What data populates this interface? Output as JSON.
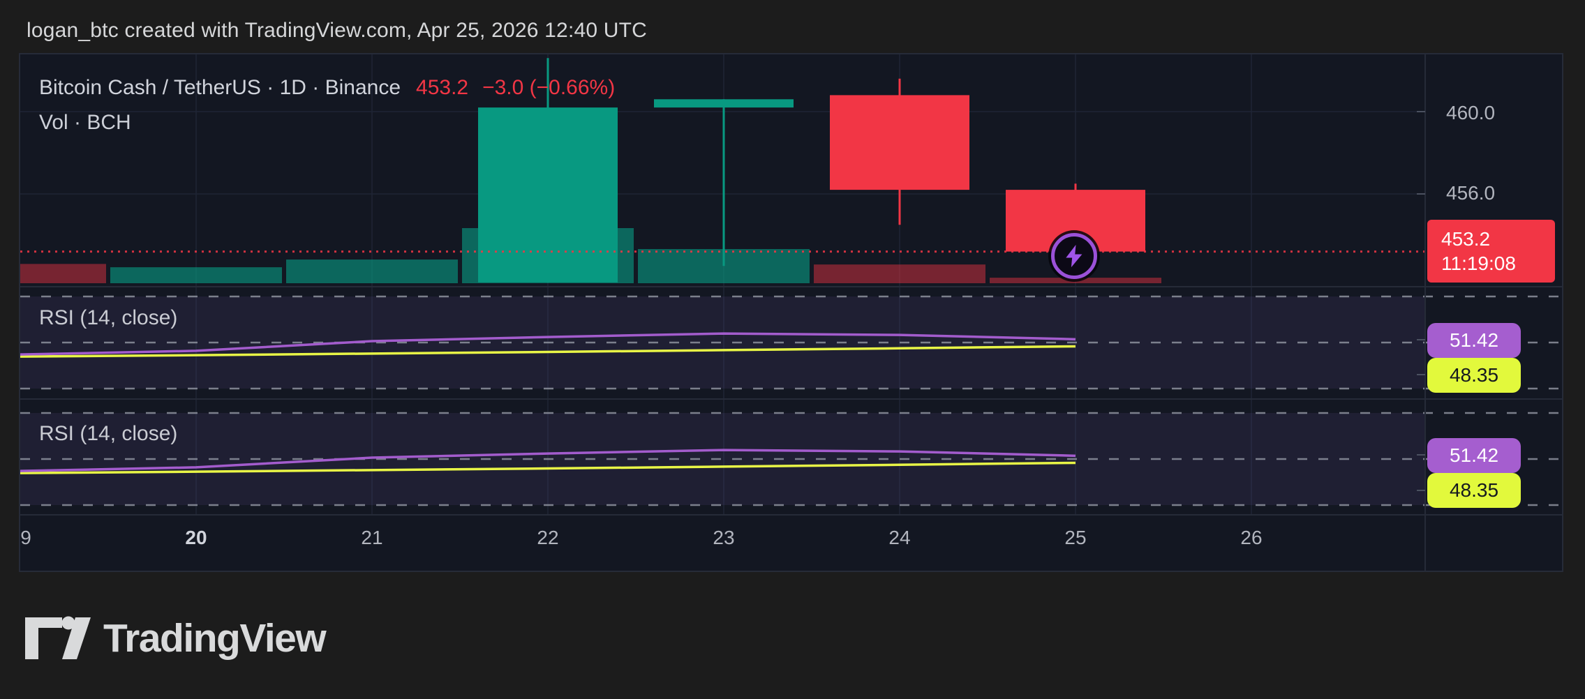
{
  "page": {
    "title": "logan_btc created with TradingView.com, Apr 25, 2026 12:40 UTC"
  },
  "legend": {
    "symbol": "Bitcoin Cash / TetherUS · 1D · Binance",
    "last_price": "453.2",
    "change": "−3.0 (−0.66%)",
    "volume_row": "Vol · BCH"
  },
  "price_axis": {
    "gridline_labels": [
      "460.0",
      "456.0"
    ],
    "last_price_badge": {
      "price": "453.2",
      "time": "11:19:08"
    }
  },
  "rsi_panels": [
    {
      "label": "RSI (14, close)",
      "rsi_value": "51.42",
      "ma_value": "48.35"
    },
    {
      "label": "RSI (14, close)",
      "rsi_value": "51.42",
      "ma_value": "48.35"
    }
  ],
  "time_axis": {
    "labels": [
      {
        "text": "9",
        "bold": false
      },
      {
        "text": "20",
        "bold": true
      },
      {
        "text": "21",
        "bold": false
      },
      {
        "text": "22",
        "bold": false
      },
      {
        "text": "23",
        "bold": false
      },
      {
        "text": "24",
        "bold": false
      },
      {
        "text": "25",
        "bold": false
      },
      {
        "text": "26",
        "bold": false
      }
    ]
  },
  "footer": {
    "brand": "TradingView",
    "logo_icon": "tradingview-logo-mark"
  },
  "icons": {
    "marker": "lightning-bolt-icon"
  },
  "colors": {
    "page_bg": "#1c1c1c",
    "chart_bg": "#131722",
    "grid": "#1f2534",
    "separator": "#262b38",
    "text_primary": "#d1d4dc",
    "text_secondary": "#b2b5be",
    "up": "#089981",
    "down": "#f23645",
    "volume_up": "rgba(8,153,129,0.62)",
    "volume_down": "rgba(242,54,69,0.45)",
    "last_price_line": "#f23645",
    "rsi_line": "#a35ccd",
    "rsi_ma_line": "#e8f546",
    "rsi_level_dash": "#8d919d",
    "rsi_band_fill": "rgba(135,105,210,0.10)",
    "marker_ring": "#9b51d8"
  },
  "chart_data": {
    "type": "candlestick+volume+rsi",
    "title": "Bitcoin Cash / TetherUS · 1D · Binance",
    "price_panel": {
      "y_ticks": [
        460.0,
        456.0
      ],
      "last_price": 453.2,
      "last_price_time": "11:19:08",
      "candles": [
        {
          "date": 22,
          "open": 451.7,
          "high": 462.6,
          "low": 451.7,
          "close": 460.2,
          "direction": "up"
        },
        {
          "date": 23,
          "open": 460.2,
          "high": 460.6,
          "low": 452.5,
          "close": 460.6,
          "direction": "up"
        },
        {
          "date": 24,
          "open": 460.8,
          "high": 461.6,
          "low": 454.5,
          "close": 456.2,
          "direction": "down"
        },
        {
          "date": 25,
          "open": 456.2,
          "high": 456.5,
          "low": 453.2,
          "close": 453.2,
          "direction": "down"
        }
      ],
      "volume_bars": [
        {
          "date": 19,
          "rel_height": 0.35,
          "direction": "down"
        },
        {
          "date": 20,
          "rel_height": 0.29,
          "direction": "up"
        },
        {
          "date": 21,
          "rel_height": 0.43,
          "direction": "up"
        },
        {
          "date": 22,
          "rel_height": 1.0,
          "direction": "up"
        },
        {
          "date": 23,
          "rel_height": 0.62,
          "direction": "up"
        },
        {
          "date": 24,
          "rel_height": 0.34,
          "direction": "down"
        },
        {
          "date": 25,
          "rel_height": 0.1,
          "direction": "down"
        }
      ]
    },
    "rsi_panels": [
      {
        "label": "RSI (14, close)",
        "levels": [
          70,
          50,
          30
        ],
        "dates": [
          19,
          20,
          21,
          22,
          23,
          24,
          25
        ],
        "rsi_series": [
          44.8,
          46.4,
          50.6,
          52.4,
          53.9,
          53.3,
          51.42
        ],
        "ma_series": [
          43.9,
          44.5,
          45.2,
          45.9,
          46.7,
          47.5,
          48.35
        ],
        "last_rsi": 51.42,
        "last_ma": 48.35
      },
      {
        "label": "RSI (14, close)",
        "levels": [
          70,
          50,
          30
        ],
        "dates": [
          19,
          20,
          21,
          22,
          23,
          24,
          25
        ],
        "rsi_series": [
          44.8,
          46.4,
          50.6,
          52.4,
          53.9,
          53.3,
          51.42
        ],
        "ma_series": [
          43.9,
          44.5,
          45.2,
          45.9,
          46.7,
          47.5,
          48.35
        ],
        "last_rsi": 51.42,
        "last_ma": 48.35
      }
    ],
    "x_axis": {
      "dates": [
        "9",
        "20",
        "21",
        "22",
        "23",
        "24",
        "25",
        "26"
      ],
      "bold_dates": [
        "20"
      ]
    }
  }
}
